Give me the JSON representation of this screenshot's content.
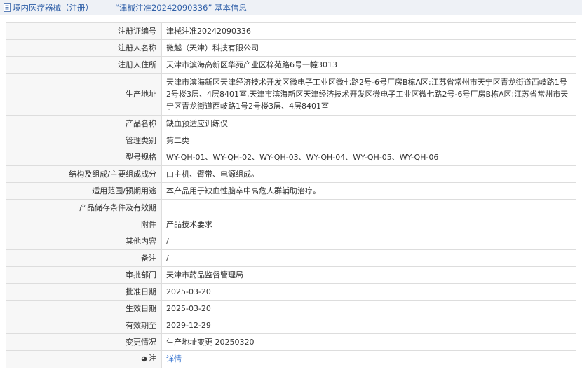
{
  "header": {
    "breadcrumb_category": "境内医疗器械（注册）",
    "separator": "——",
    "record_title": "“津械注准20242090336” 基本信息"
  },
  "rows": [
    {
      "label": "注册证编号",
      "value": "津械注准20242090336"
    },
    {
      "label": "注册人名称",
      "value": "微越（天津）科技有限公司"
    },
    {
      "label": "注册人住所",
      "value": "天津市滨海高新区华苑产业区梓苑路6号一幢3013"
    },
    {
      "label": "生产地址",
      "value": "天津市滨海新区天津经济技术开发区微电子工业区微七路2号-6号厂房B栋A区;江苏省常州市天宁区青龙街道西岐路1号2号楼3层、4层8401室,天津市滨海新区天津经济技术开发区微电子工业区微七路2号-6号厂房B栋A区;江苏省常州市天宁区青龙街道西岐路1号2号楼3层、4层8401室"
    },
    {
      "label": "产品名称",
      "value": "缺血预适应训练仪"
    },
    {
      "label": "管理类别",
      "value": "第二类"
    },
    {
      "label": "型号规格",
      "value": "WY-QH-01、WY-QH-02、WY-QH-03、WY-QH-04、WY-QH-05、WY-QH-06"
    },
    {
      "label": "结构及组成/主要组成成分",
      "value": "由主机、臂带、电源组成。"
    },
    {
      "label": "适用范围/预期用途",
      "value": "本产品用于缺血性脑卒中高危人群辅助治疗。"
    },
    {
      "label": "产品储存条件及有效期",
      "value": ""
    },
    {
      "label": "附件",
      "value": "产品技术要求"
    },
    {
      "label": "其他内容",
      "value": "/"
    },
    {
      "label": "备注",
      "value": "/"
    },
    {
      "label": "审批部门",
      "value": "天津市药品监督管理局"
    },
    {
      "label": "批准日期",
      "value": "2025-03-20"
    },
    {
      "label": "生效日期",
      "value": "2025-03-20"
    },
    {
      "label": "有效期至",
      "value": "2029-12-29"
    },
    {
      "label": "变更情况",
      "value": "生产地址变更 20250320"
    }
  ],
  "note_row": {
    "label": "注",
    "link_text": "详情",
    "icon": "pin-icon"
  },
  "colors": {
    "link": "#2f6fce",
    "title": "#2f5fa8",
    "border": "#dddddd"
  }
}
